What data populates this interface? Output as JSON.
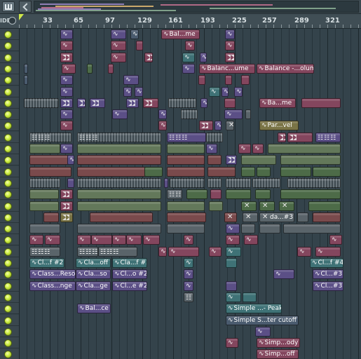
{
  "toolbar": {
    "ui_icon": "ui-layout-icon",
    "back_icon": "chevron-left-icon"
  },
  "ruler": {
    "side_label": "IDE",
    "ticks": [
      "33",
      "65",
      "97",
      "129",
      "161",
      "193",
      "225",
      "257",
      "289",
      "321"
    ]
  },
  "track_count": 29,
  "clip_labels": {
    "t1_bal": "Bal...me",
    "t4_bal1": "Balanc...ume",
    "t4_bal2": "Balance -...olume",
    "t7_bal": "Ba...me",
    "t9_par": "Par...vel",
    "t17_da": "da...#3",
    "t20_c1": "Cl...f #2",
    "t20_c2": "Cla...off",
    "t20_c3": "Cla...f #3",
    "t20_c4": "Cl...f #4",
    "t21_c1": "Class...Reso",
    "t21_c2": "Cla...so",
    "t21_c3": "Cl...o #2",
    "t21_c4": "Cl...#3",
    "t22_c1": "Class...nge",
    "t22_c2": "Cla...ge",
    "t22_c3": "Cl...e #2",
    "t22_c4": "Cl...#3",
    "t24_bal": "Bal...ce",
    "t24_simple": "Simple ...- Peak",
    "t25_simple": "Simple S...ter cutoff",
    "t27_simp": "Simp...ody",
    "t28_simp": "Simp...off"
  },
  "colors": {
    "led": "#c9ea3e",
    "playhead": "#cfe84a",
    "automation_clip": "#5b4f86",
    "pink_clip": "#84465e"
  }
}
